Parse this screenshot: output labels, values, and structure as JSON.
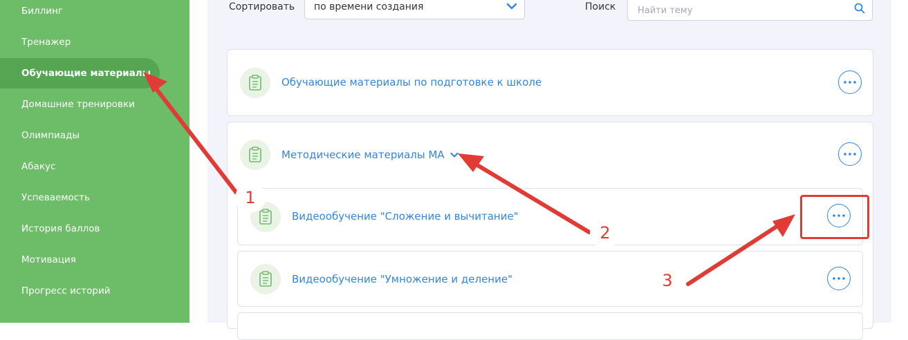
{
  "sidebar": {
    "items": [
      {
        "label": "Биллинг"
      },
      {
        "label": "Тренажер"
      },
      {
        "label": "Обучающие материалы",
        "active": true
      },
      {
        "label": "Домашние тренировки"
      },
      {
        "label": "Олимпиады"
      },
      {
        "label": "Абакус"
      },
      {
        "label": "Успеваемость"
      },
      {
        "label": "История баллов"
      },
      {
        "label": "Мотивация"
      },
      {
        "label": "Прогресс историй"
      }
    ]
  },
  "toolbar": {
    "sort_label": "Сортировать",
    "sort_value": "по времени создания",
    "search_label": "Поиск",
    "search_placeholder": "Найти тему"
  },
  "materials": {
    "card1_title": "Обучающие материалы по подготовке к школе",
    "card2_title": "Методические материалы МА",
    "sub1_title": "Видеообучение \"Сложение и вычитание\"",
    "sub2_title": "Видеообучение \"Умножение и деление\""
  },
  "annotations": {
    "n1": "1",
    "n2": "2",
    "n3": "3",
    "color": "#e03b34"
  },
  "colors": {
    "sidebar": "#6cbc68",
    "sidebar_active": "#56a552",
    "accent": "#2f86e3",
    "background": "#f2f3fb"
  }
}
